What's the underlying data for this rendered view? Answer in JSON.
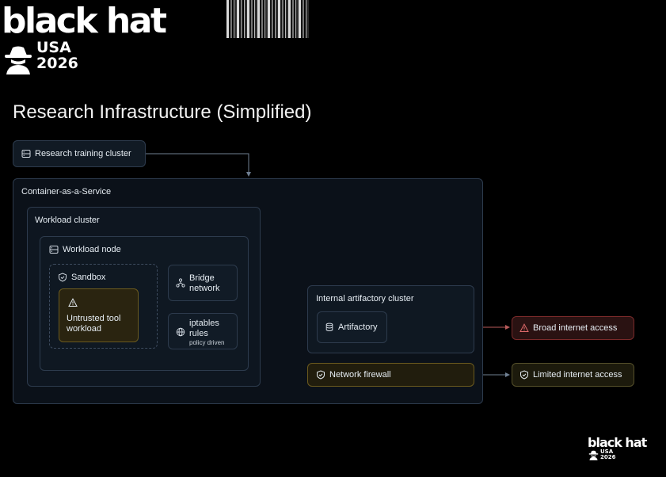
{
  "logo": {
    "word": "black hat",
    "line1": "USA",
    "line2": "2026"
  },
  "slide": {
    "title": "Research Infrastructure (Simplified)"
  },
  "diagram": {
    "research_cluster": "Research training cluster",
    "caas": "Container-as-a-Service",
    "workload_cluster": "Workload cluster",
    "workload_node": "Workload node",
    "sandbox": "Sandbox",
    "untrusted_line1": "Untrusted tool",
    "untrusted_line2": "workload",
    "bridge_line1": "Bridge",
    "bridge_line2": "network",
    "iptables_line1": "iptables",
    "iptables_line2": "rules",
    "iptables_note": "policy driven",
    "artifactory_cluster": "Internal artifactory cluster",
    "artifactory": "Artifactory",
    "firewall": "Network firewall",
    "broad": "Broad internet access",
    "limited": "Limited internet access"
  },
  "colors": {
    "accent_warning": "#e0b84a",
    "accent_danger": "#e06a6a",
    "box_border": "#2d3b4d",
    "connector": "#6f7f92"
  }
}
